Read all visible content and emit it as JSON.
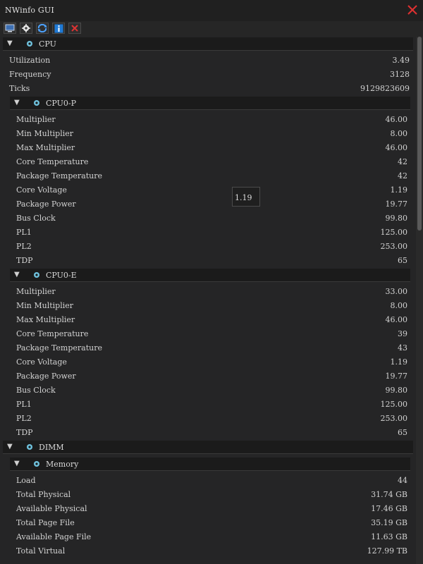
{
  "window": {
    "title": "NWinfo GUI",
    "accent_close": "#e03030"
  },
  "toolbar": {
    "buttons": [
      {
        "name": "window-icon-button",
        "icon": "monitor-icon"
      },
      {
        "name": "settings-icon-button",
        "icon": "gear-icon"
      },
      {
        "name": "refresh-icon-button",
        "icon": "refresh-icon"
      },
      {
        "name": "info-icon-button",
        "icon": "info-icon"
      },
      {
        "name": "close-x-icon-button",
        "icon": "x-icon"
      }
    ]
  },
  "tree": {
    "cpu": {
      "label": "CPU",
      "rows": [
        {
          "k": "Utilization",
          "v": "3.49"
        },
        {
          "k": "Frequency",
          "v": "3128"
        },
        {
          "k": "Ticks",
          "v": "9129823609"
        }
      ],
      "p_core": {
        "label": "CPU0-P",
        "rows": [
          {
            "k": "Multiplier",
            "v": "46.00"
          },
          {
            "k": "Min Multiplier",
            "v": "8.00"
          },
          {
            "k": "Max Multiplier",
            "v": "46.00"
          },
          {
            "k": "Core Temperature",
            "v": "42"
          },
          {
            "k": "Package Temperature",
            "v": "42"
          },
          {
            "k": "Core Voltage",
            "v": "1.19"
          },
          {
            "k": "Package Power",
            "v": "19.77"
          },
          {
            "k": "Bus Clock",
            "v": "99.80"
          },
          {
            "k": "PL1",
            "v": "125.00"
          },
          {
            "k": "PL2",
            "v": "253.00"
          },
          {
            "k": "TDP",
            "v": "65"
          }
        ]
      },
      "e_core": {
        "label": "CPU0-E",
        "rows": [
          {
            "k": "Multiplier",
            "v": "33.00"
          },
          {
            "k": "Min Multiplier",
            "v": "8.00"
          },
          {
            "k": "Max Multiplier",
            "v": "46.00"
          },
          {
            "k": "Core Temperature",
            "v": "39"
          },
          {
            "k": "Package Temperature",
            "v": "43"
          },
          {
            "k": "Core Voltage",
            "v": "1.19"
          },
          {
            "k": "Package Power",
            "v": "19.77"
          },
          {
            "k": "Bus Clock",
            "v": "99.80"
          },
          {
            "k": "PL1",
            "v": "125.00"
          },
          {
            "k": "PL2",
            "v": "253.00"
          },
          {
            "k": "TDP",
            "v": "65"
          }
        ]
      }
    },
    "dimm": {
      "label": "DIMM",
      "memory": {
        "label": "Memory",
        "rows": [
          {
            "k": "Load",
            "v": "44"
          },
          {
            "k": "Total Physical",
            "v": "31.74 GB"
          },
          {
            "k": "Available Physical",
            "v": "17.46 GB"
          },
          {
            "k": "Total Page File",
            "v": "35.19 GB"
          },
          {
            "k": "Available Page File",
            "v": "11.63 GB"
          },
          {
            "k": "Total Virtual",
            "v": "127.99 TB"
          }
        ]
      }
    }
  },
  "tooltip": {
    "text": "1.19"
  }
}
